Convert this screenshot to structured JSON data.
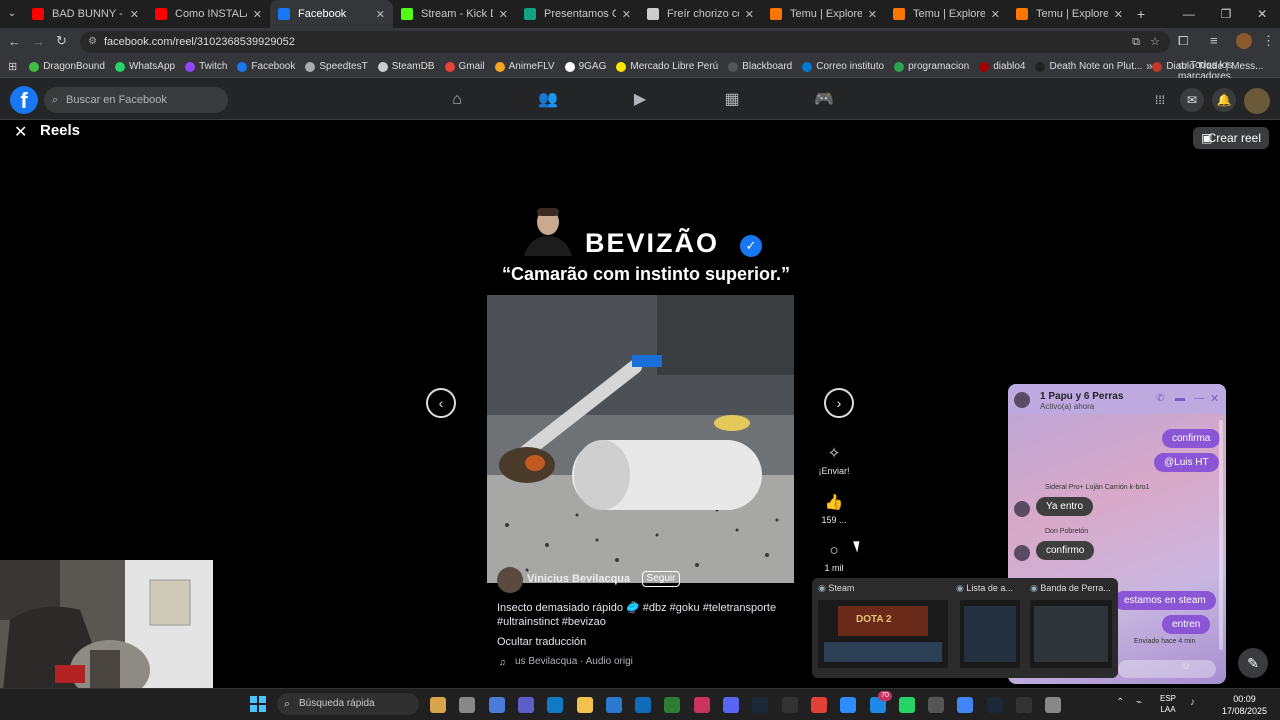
{
  "browser": {
    "tabs": [
      {
        "title": "BAD BUNNY - NI BIEN",
        "color": "#ff0000"
      },
      {
        "title": "Como INSTALAR MO",
        "color": "#ff0000"
      },
      {
        "title": "Facebook",
        "color": "#1877f2",
        "active": true
      },
      {
        "title": "Stream - Kick Dashbo",
        "color": "#53fc18"
      },
      {
        "title": "Presentamos ChatGP",
        "color": "#10a37f"
      },
      {
        "title": "Freír chorizo con plá",
        "color": "#cccccc"
      },
      {
        "title": "Temu | Explore the La",
        "color": "#fb7701"
      },
      {
        "title": "Temu | Explore the La",
        "color": "#fb7701"
      },
      {
        "title": "Temu | Explore the La",
        "color": "#fb7701"
      }
    ],
    "new_tab": "+",
    "url": "facebook.com/reel/3102368539929052",
    "bookmarks": [
      {
        "label": "DragonBound",
        "color": "#3fbf3f"
      },
      {
        "label": "WhatsApp",
        "color": "#25d366"
      },
      {
        "label": "Twitch",
        "color": "#9146ff"
      },
      {
        "label": "Facebook",
        "color": "#1877f2"
      },
      {
        "label": "SpeedtesT",
        "color": "#aaaaaa"
      },
      {
        "label": "SteamDB",
        "color": "#cccccc"
      },
      {
        "label": "Gmail",
        "color": "#ea4335"
      },
      {
        "label": "AnimeFLV",
        "color": "#f5a623"
      },
      {
        "label": "9GAG",
        "color": "#ffffff"
      },
      {
        "label": "Mercado Libre Perú",
        "color": "#ffe600"
      },
      {
        "label": "Blackboard",
        "color": "#555555"
      },
      {
        "label": "Correo instituto",
        "color": "#0078d4"
      },
      {
        "label": "programacion",
        "color": "#2ea44f"
      },
      {
        "label": "diablo4",
        "color": "#a00000"
      },
      {
        "label": "Death Note on Plut...",
        "color": "#222222"
      },
      {
        "label": "Diablo Trade | Mess...",
        "color": "#c0392b"
      }
    ],
    "bookmarks_more": "»",
    "all_bookmarks": "Todos los marcadores"
  },
  "facebook": {
    "logo": "f",
    "search_placeholder": "Buscar en Facebook",
    "reels_title": "Reels",
    "crear_reel": "Crear reel"
  },
  "reel": {
    "channel_name": "BEVIZÃO",
    "quote": "“Camarão com instinto superior.”",
    "author": "Vinicius Bevilacqua",
    "follow": "Seguir",
    "caption": "Insecto demasiado rápido 🥏 #dbz #goku #teletransporte #ultrainstinct #bevizao",
    "hide_translation": "Ocultar traducción",
    "audio": "us Bevilacqua · Audio origi",
    "actions": {
      "send_label": "¡Enviar!",
      "likes": "159 ...",
      "comments": "1 mil"
    }
  },
  "chat": {
    "title": "1 Papu y 6 Perras",
    "subtitle": "Activo(a) ahora",
    "messages": [
      {
        "text": "confirma",
        "mine": true
      },
      {
        "text": "@Luis HT",
        "mine": true
      },
      {
        "sender": "Sideral Pro+ Luján Carrión k-bro1",
        "text": "Ya entro",
        "mine": false
      },
      {
        "sender": "Don Pobretón",
        "text": "confirmo",
        "mine": false
      },
      {
        "text": "estamos en steam",
        "mine": true
      },
      {
        "text": "entren",
        "mine": true
      }
    ],
    "sent_status": "Enviado hace 4 min"
  },
  "previews": {
    "steam_label": "Steam",
    "list_label": "Lista de a...",
    "banda_label": "Banda de Perra...",
    "dota_text": "DOTA 2"
  },
  "taskbar": {
    "search_placeholder": "Búsqueda rápida",
    "lang": "ESP",
    "lang_sub": "LAA",
    "time": "00:09",
    "date": "17/08/2025",
    "notif_badge": "70"
  }
}
